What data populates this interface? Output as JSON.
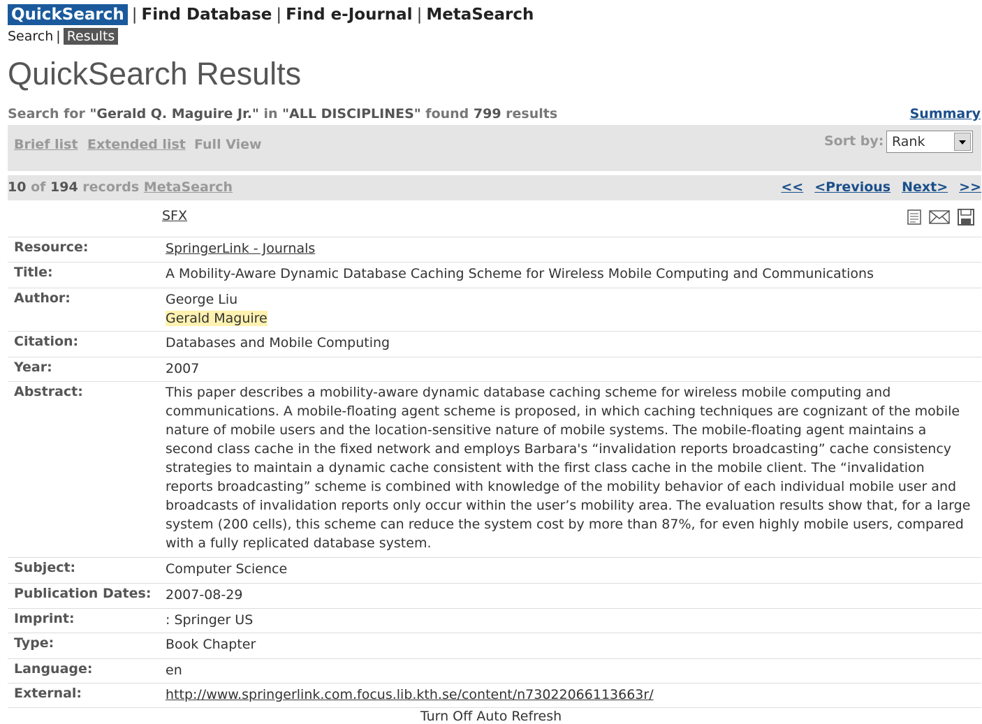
{
  "topnav": {
    "quicksearch": "QuickSearch",
    "find_database": "Find Database",
    "find_ejournal": "Find e-Journal",
    "metasearch": "MetaSearch",
    "separator": "|"
  },
  "subnav": {
    "search": "Search",
    "results": "Results",
    "separator": "|"
  },
  "page_title": "QuickSearch Results",
  "search_info": {
    "prefix": "Search for ",
    "query": "\"Gerald Q. Maguire Jr.\"",
    "in_text": " in ",
    "discipline": "\"ALL DISCIPLINES\"",
    "found_text": " found ",
    "count": "799",
    "suffix": " results"
  },
  "summary_link": "Summary",
  "views": {
    "brief": "Brief list",
    "extended": "Extended list",
    "full": "Full View"
  },
  "sort": {
    "label": "Sort by:",
    "value": "Rank"
  },
  "records": {
    "shown": "10",
    "of_text": " of ",
    "total": "194",
    "records_text": " records ",
    "metasearch_link": "MetaSearch"
  },
  "pager": {
    "first": "<<",
    "previous": "<Previous",
    "next": "Next>",
    "last": ">>"
  },
  "sfx_link": "SFX",
  "icons": [
    "details-icon",
    "email-icon",
    "save-icon"
  ],
  "record": {
    "resource_label": "Resource:",
    "resource": "SpringerLink - Journals",
    "title_label": "Title:",
    "title": "A Mobility-Aware Dynamic Database Caching Scheme for Wireless Mobile Computing and Communications",
    "author_label": "Author:",
    "authors": [
      "George Liu",
      "Gerald Maguire"
    ],
    "citation_label": "Citation:",
    "citation": "Databases and Mobile Computing",
    "year_label": "Year:",
    "year": "2007",
    "abstract_label": "Abstract:",
    "abstract": "This paper describes a mobility-aware dynamic database caching scheme for wireless mobile computing and communications. A mobile-floating agent scheme is proposed, in which caching techniques are cognizant of the mobile nature of mobile users and the location-sensitive nature of mobile systems. The mobile-floating agent maintains a second class cache in the fixed network and employs Barbara's “invalidation reports broadcasting” cache consistency strategies to maintain a dynamic cache consistent with the first class cache in the mobile client. The “invalidation reports broadcasting” scheme is combined with knowledge of the mobility behavior of each individual mobile user and broadcasts of invalidation reports only occur within the user’s mobility area. The evaluation results show that, for a large system (200 cells), this scheme can reduce the system cost by more than 87%, for even highly mobile users, compared with a fully replicated database system.",
    "subject_label": "Subject:",
    "subject": "Computer Science",
    "pubdates_label": "Publication Dates:",
    "pubdates": "2007-08-29",
    "imprint_label": "Imprint:",
    "imprint": ": Springer US",
    "type_label": "Type:",
    "type": "Book Chapter",
    "language_label": "Language:",
    "language": "en",
    "external_label": "External:",
    "external": "http://www.springerlink.com.focus.lib.kth.se/content/n73022066113663r/"
  },
  "footer": "Turn Off Auto Refresh",
  "colors": {
    "accent": "#1a5a9c",
    "link": "#1a4f8a",
    "bar_bg": "#e5e5e5",
    "highlight": "#fff2b0"
  }
}
